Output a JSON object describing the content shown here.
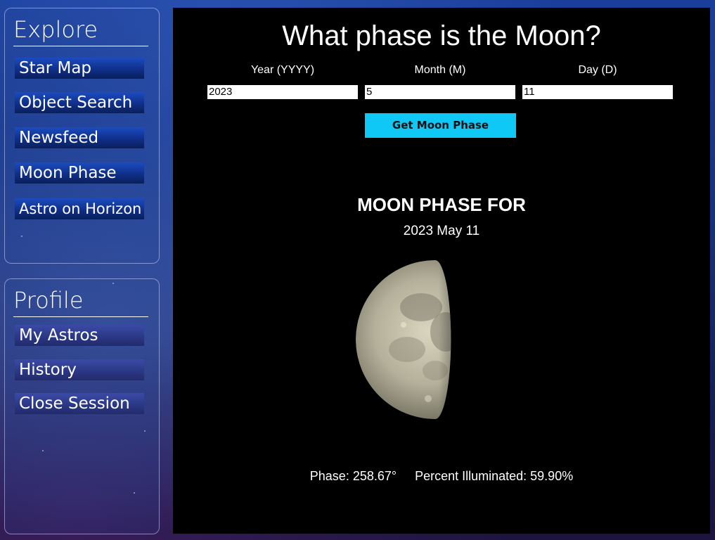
{
  "sidebar": {
    "explore": {
      "title": "Explore",
      "items": [
        {
          "label": "Star Map"
        },
        {
          "label": "Object Search"
        },
        {
          "label": "Newsfeed"
        },
        {
          "label": "Moon Phase"
        },
        {
          "label": "Astro on Horizon"
        }
      ]
    },
    "profile": {
      "title": "Profile",
      "items": [
        {
          "label": "My Astros"
        },
        {
          "label": "History"
        },
        {
          "label": "Close Session"
        }
      ]
    }
  },
  "main": {
    "title": "What phase is the Moon?",
    "fields": {
      "year": {
        "label": "Year (YYYY)",
        "value": "2023"
      },
      "month": {
        "label": "Month (M)",
        "value": "5"
      },
      "day": {
        "label": "Day (D)",
        "value": "11"
      }
    },
    "button_label": "Get Moon Phase",
    "result": {
      "heading": "MOON PHASE FOR",
      "date": "2023 May 11",
      "phase": "Phase: 258.67°",
      "illuminated": "Percent Illuminated: 59.90%",
      "illuminated_fraction": 0.599
    }
  },
  "colors": {
    "button_bg": "#0fc8f5",
    "main_bg": "#000000",
    "nav_blue": "#0f2f8a"
  }
}
